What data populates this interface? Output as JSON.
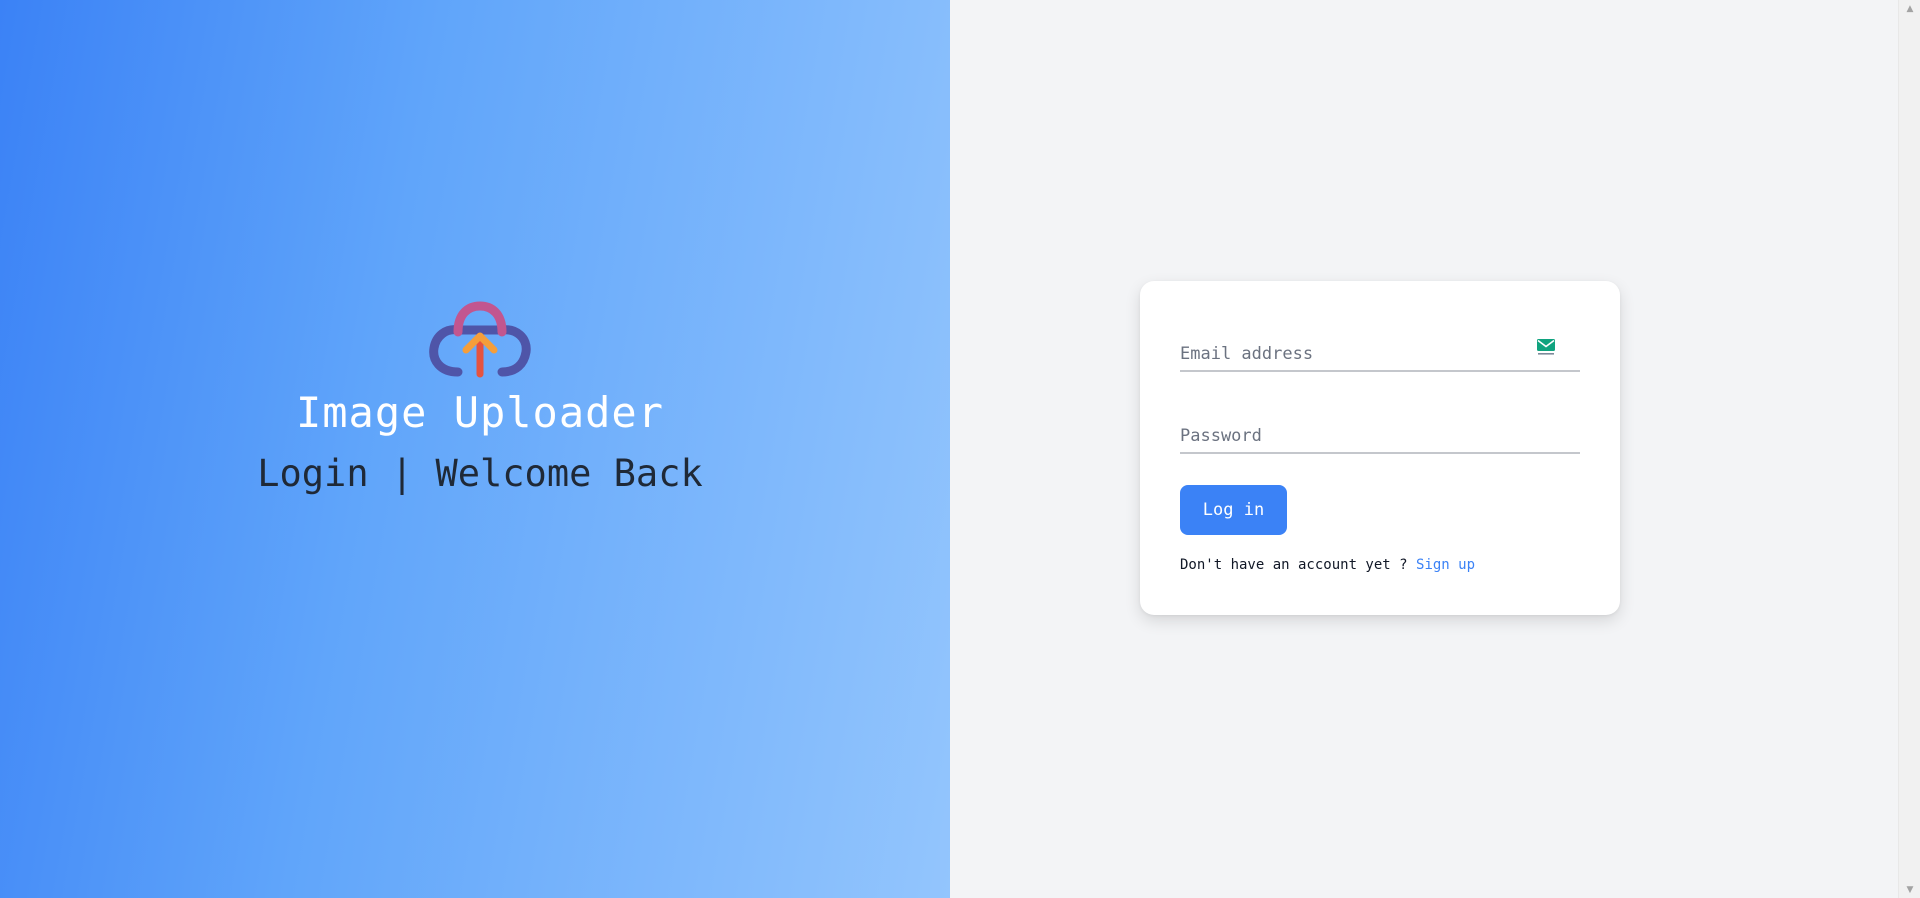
{
  "brand": {
    "title": "Image Uploader",
    "subtitle": "Login | Welcome Back",
    "logo_icon": "cloud-upload-logo",
    "colors": {
      "cloud_body": "#4f55a8",
      "cloud_top": "#c2568f",
      "arrow": "#f59e3a",
      "arrow_stem": "#e5533f"
    }
  },
  "form": {
    "email_placeholder": "Email address",
    "email_icon": "mail-icon",
    "password_placeholder": "Password",
    "login_label": "Log in",
    "signup_prompt": "Don't have an account yet ?",
    "signup_link": "Sign up"
  },
  "colors": {
    "accent": "#3b82f6",
    "gradient_start": "#3b82f6",
    "gradient_end": "#93c5fd",
    "page_background": "#f3f4f6",
    "card_background": "#ffffff"
  }
}
